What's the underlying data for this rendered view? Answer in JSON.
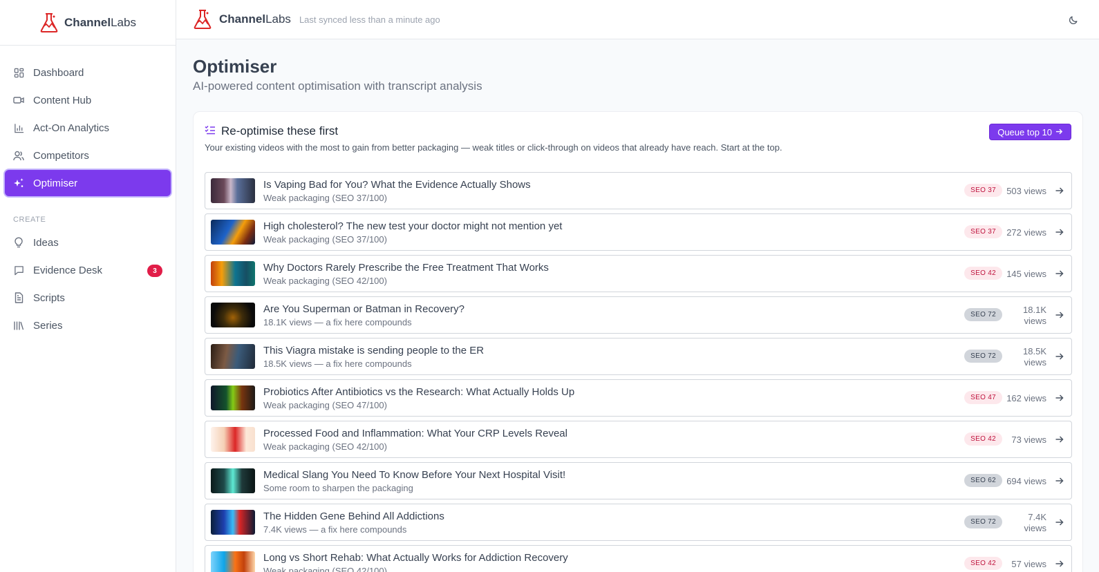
{
  "app": {
    "brand_bold": "Channel",
    "brand_light": "Labs",
    "sync_status": "Last synced less than a minute ago"
  },
  "sidebar": {
    "items": [
      {
        "label": "Dashboard",
        "icon": "dashboard-icon"
      },
      {
        "label": "Content Hub",
        "icon": "video-icon"
      },
      {
        "label": "Act-On Analytics",
        "icon": "bar-chart-icon"
      },
      {
        "label": "Competitors",
        "icon": "users-icon"
      },
      {
        "label": "Optimiser",
        "icon": "sparkles-icon",
        "active": true
      }
    ],
    "section_create": "CREATE",
    "create_items": [
      {
        "label": "Ideas",
        "icon": "lightbulb-icon"
      },
      {
        "label": "Evidence Desk",
        "icon": "message-icon",
        "badge": "3"
      },
      {
        "label": "Scripts",
        "icon": "document-icon"
      },
      {
        "label": "Series",
        "icon": "library-icon"
      }
    ]
  },
  "page": {
    "title": "Optimiser",
    "subtitle": "AI-powered content optimisation with transcript analysis"
  },
  "card": {
    "title": "Re-optimise these first",
    "description": "Your existing videos with the most to gain from better packaging — weak titles or click-through on videos that already have reach. Start at the top.",
    "queue_button": "Queue top 10"
  },
  "videos": [
    {
      "title": "Is Vaping Bad for You? What the Evidence Actually Shows",
      "sub": "Weak packaging (SEO 37/100)",
      "seo": "SEO 37",
      "views": "503 views",
      "level": "low"
    },
    {
      "title": "High cholesterol? The new test your doctor might not mention yet",
      "sub": "Weak packaging (SEO 37/100)",
      "seo": "SEO 37",
      "views": "272 views",
      "level": "low"
    },
    {
      "title": "Why Doctors Rarely Prescribe the Free Treatment That Works",
      "sub": "Weak packaging (SEO 42/100)",
      "seo": "SEO 42",
      "views": "145 views",
      "level": "low"
    },
    {
      "title": "Are You Superman or Batman in Recovery?",
      "sub": "18.1K views — a fix here compounds",
      "seo": "SEO 72",
      "views": "18.1K views",
      "level": "mid"
    },
    {
      "title": "This Viagra mistake is sending people to the ER",
      "sub": "18.5K views — a fix here compounds",
      "seo": "SEO 72",
      "views": "18.5K views",
      "level": "mid"
    },
    {
      "title": "Probiotics After Antibiotics vs the Research: What Actually Holds Up",
      "sub": "Weak packaging (SEO 47/100)",
      "seo": "SEO 47",
      "views": "162 views",
      "level": "low"
    },
    {
      "title": "Processed Food and Inflammation: What Your CRP Levels Reveal",
      "sub": "Weak packaging (SEO 42/100)",
      "seo": "SEO 42",
      "views": "73 views",
      "level": "low"
    },
    {
      "title": "Medical Slang You Need To Know Before Your Next Hospital Visit!",
      "sub": "Some room to sharpen the packaging",
      "seo": "SEO 62",
      "views": "694 views",
      "level": "mid"
    },
    {
      "title": "The Hidden Gene Behind All Addictions",
      "sub": "7.4K views — a fix here compounds",
      "seo": "SEO 72",
      "views": "7.4K views",
      "level": "mid"
    },
    {
      "title": "Long vs Short Rehab: What Actually Works for Addiction Recovery",
      "sub": "Weak packaging (SEO 42/100)",
      "seo": "SEO 42",
      "views": "57 views",
      "level": "low"
    }
  ],
  "colors": {
    "accent": "#7c3aed",
    "brand_red": "#dc2626",
    "seo_low_bg": "#fde8ec",
    "seo_low_text": "#be123c",
    "seo_mid_bg": "#d1d5db"
  }
}
